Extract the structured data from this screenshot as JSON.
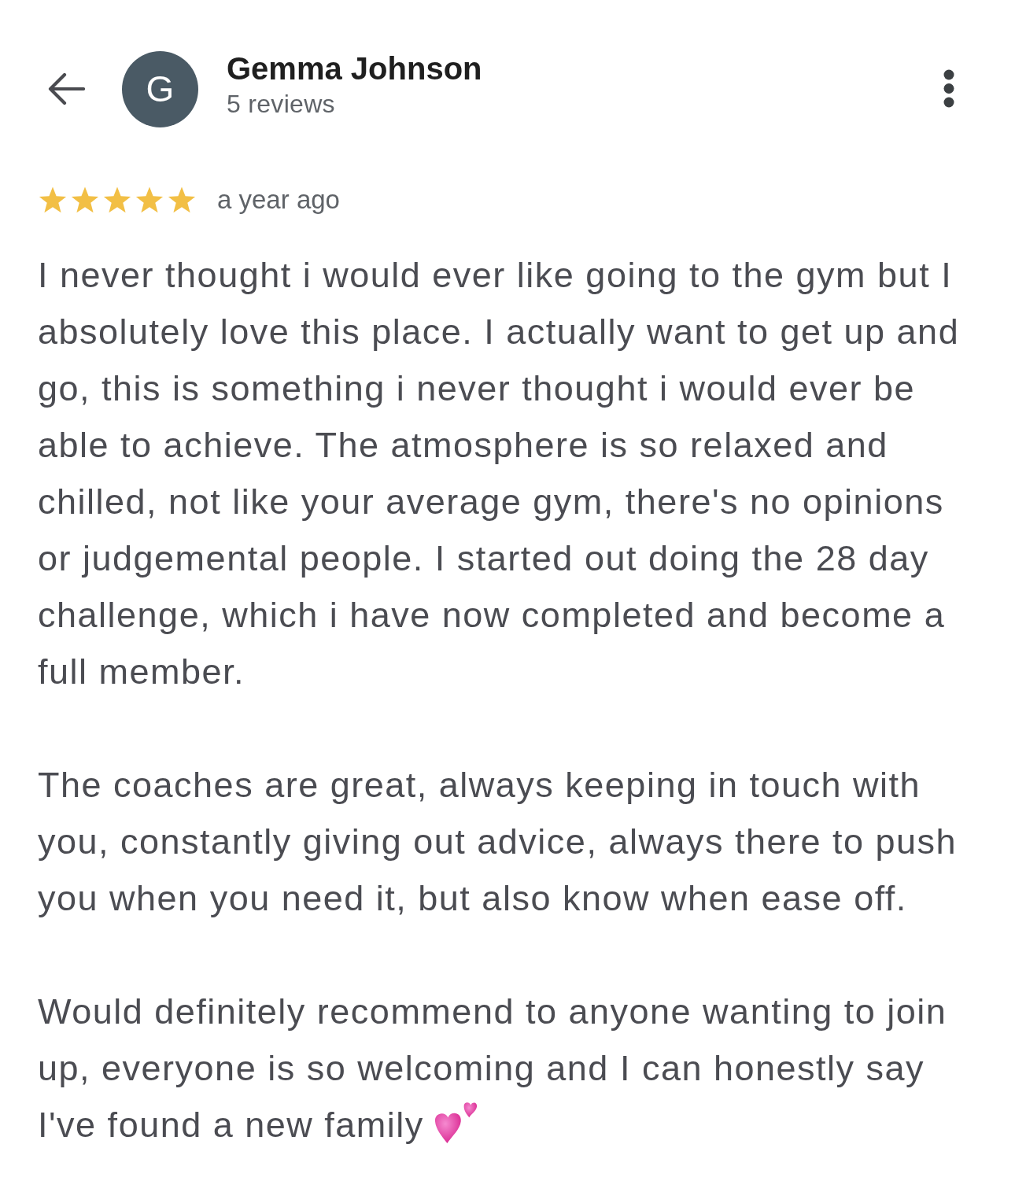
{
  "header": {
    "avatar_letter": "G",
    "name": "Gemma Johnson",
    "review_count": "5 reviews"
  },
  "review": {
    "stars": 5,
    "time": "a year ago",
    "paragraphs": [
      "I never thought i would ever like going to the gym but I absolutely love this place. I actually want to get up and go, this is something i never thought i would ever be able to achieve. The atmosphere is so relaxed and chilled, not like your average gym, there's no opinions or judgemental people. I started out doing the 28 day challenge, which i have now completed and become a full member.",
      "The coaches are great, always keeping in touch with you, constantly giving out advice, always there to push you when you need it, but also know when ease off.",
      "Would definitely recommend to anyone wanting to join up, everyone is so welcoming and I can honestly say"
    ],
    "closing_line": "I've found a new family"
  }
}
